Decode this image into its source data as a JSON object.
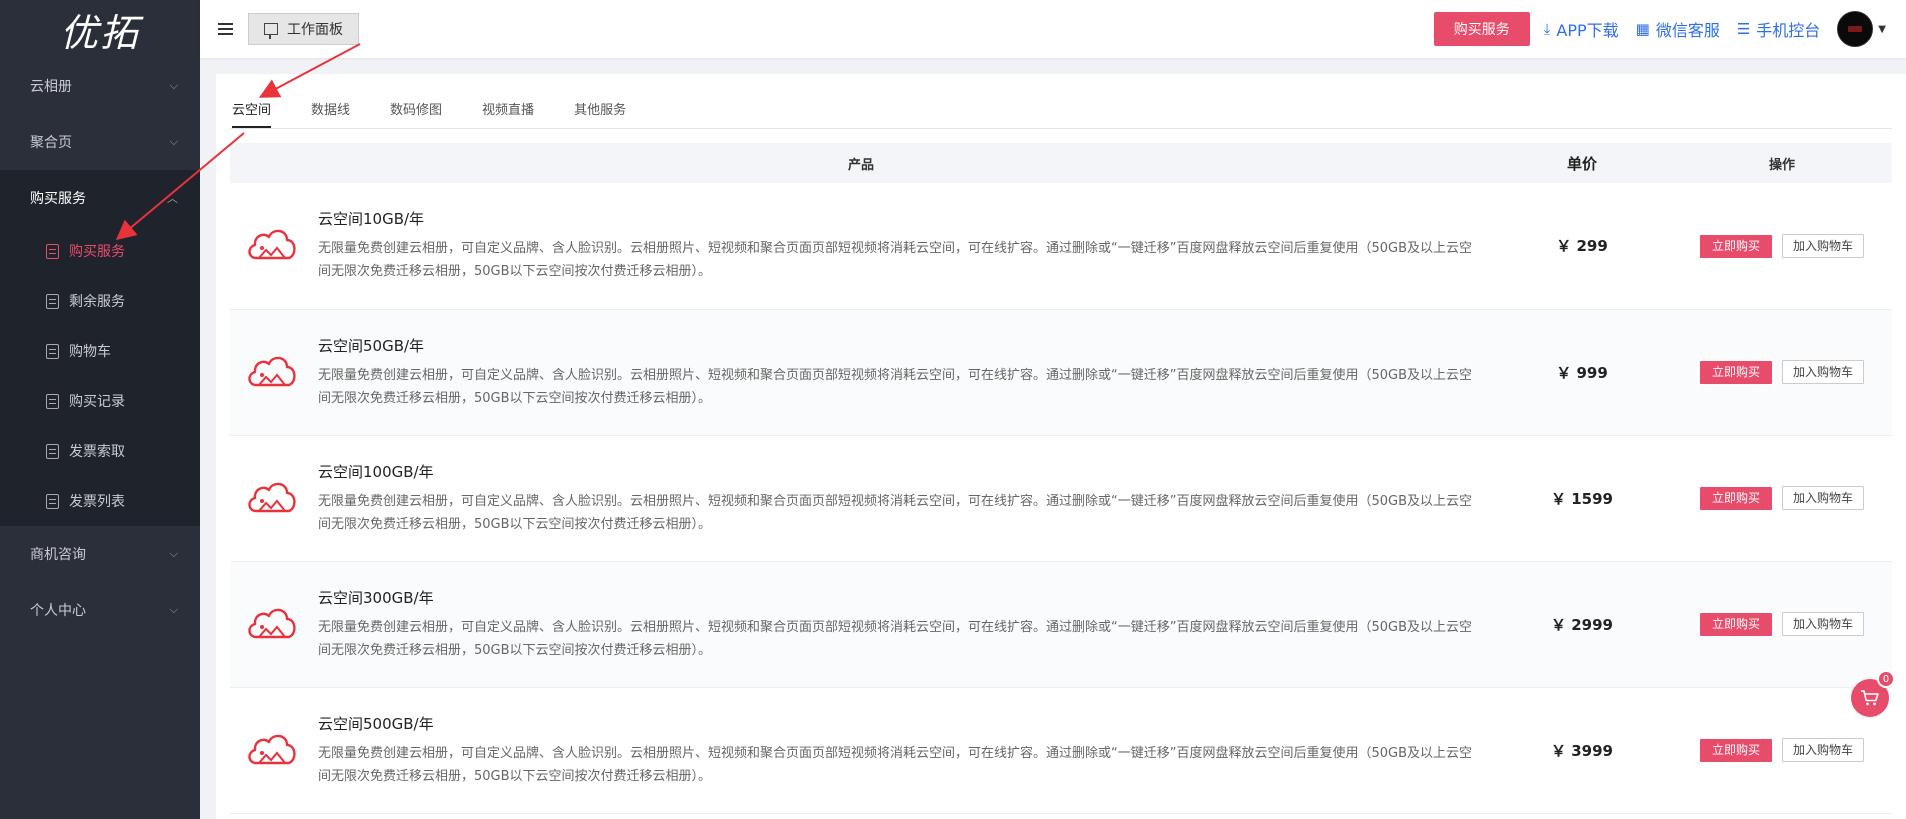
{
  "brand": {
    "logo_text": "优拓"
  },
  "sidebar": {
    "items": [
      {
        "label": "云相册"
      },
      {
        "label": "聚合页"
      },
      {
        "label": "购买服务"
      },
      {
        "label": "商机咨询"
      },
      {
        "label": "个人中心"
      }
    ],
    "submenu": [
      {
        "label": "购买服务"
      },
      {
        "label": "剩余服务"
      },
      {
        "label": "购物车"
      },
      {
        "label": "购买记录"
      },
      {
        "label": "发票索取"
      },
      {
        "label": "发票列表"
      }
    ]
  },
  "topbar": {
    "workbench_label": "工作面板",
    "buy_label": "购买服务",
    "app_download": "APP下载",
    "wechat_service": "微信客服",
    "mobile_console": "手机控台"
  },
  "tabs": [
    {
      "label": "云空间"
    },
    {
      "label": "数据线"
    },
    {
      "label": "数码修图"
    },
    {
      "label": "视频直播"
    },
    {
      "label": "其他服务"
    }
  ],
  "table": {
    "headers": {
      "product": "产品",
      "price": "单价",
      "action": "操作"
    },
    "buy_now_label": "立即购买",
    "add_cart_label": "加入购物车",
    "rows": [
      {
        "name": "云空间10GB/年",
        "desc": "无限量免费创建云相册，可自定义品牌、含人脸识别。云相册照片、短视频和聚合页面页部短视频将消耗云空间，可在线扩容。通过删除或“一键迁移”百度网盘释放云空间后重复使用（50GB及以上云空间无限次免费迁移云相册，50GB以下云空间按次付费迁移云相册）。",
        "price": "￥ 299"
      },
      {
        "name": "云空间50GB/年",
        "desc": "无限量免费创建云相册，可自定义品牌、含人脸识别。云相册照片、短视频和聚合页面页部短视频将消耗云空间，可在线扩容。通过删除或“一键迁移”百度网盘释放云空间后重复使用（50GB及以上云空间无限次免费迁移云相册，50GB以下云空间按次付费迁移云相册）。",
        "price": "￥ 999"
      },
      {
        "name": "云空间100GB/年",
        "desc": "无限量免费创建云相册，可自定义品牌、含人脸识别。云相册照片、短视频和聚合页面页部短视频将消耗云空间，可在线扩容。通过删除或“一键迁移”百度网盘释放云空间后重复使用（50GB及以上云空间无限次免费迁移云相册，50GB以下云空间按次付费迁移云相册）。",
        "price": "￥ 1599"
      },
      {
        "name": "云空间300GB/年",
        "desc": "无限量免费创建云相册，可自定义品牌、含人脸识别。云相册照片、短视频和聚合页面页部短视频将消耗云空间，可在线扩容。通过删除或“一键迁移”百度网盘释放云空间后重复使用（50GB及以上云空间无限次免费迁移云相册，50GB以下云空间按次付费迁移云相册）。",
        "price": "￥ 2999"
      },
      {
        "name": "云空间500GB/年",
        "desc": "无限量免费创建云相册，可自定义品牌、含人脸识别。云相册照片、短视频和聚合页面页部短视频将消耗云空间，可在线扩容。通过删除或“一键迁移”百度网盘释放云空间后重复使用（50GB及以上云空间无限次免费迁移云相册，50GB以下云空间按次付费迁移云相册）。",
        "price": "￥ 3999"
      }
    ]
  },
  "cart": {
    "count": "0"
  },
  "colors": {
    "accent": "#e84c6b",
    "sidebar_bg": "#2b2f3a",
    "link": "#2f6fe6",
    "annotation_arrow": "#e8323c"
  },
  "icons": {
    "menu": "hamburger-icon",
    "board": "whiteboard-icon",
    "download": "download-icon",
    "qrcode": "qrcode-icon",
    "sliders": "sliders-icon",
    "cloud": "cloud-photo-icon",
    "cart": "shopping-cart-icon"
  }
}
